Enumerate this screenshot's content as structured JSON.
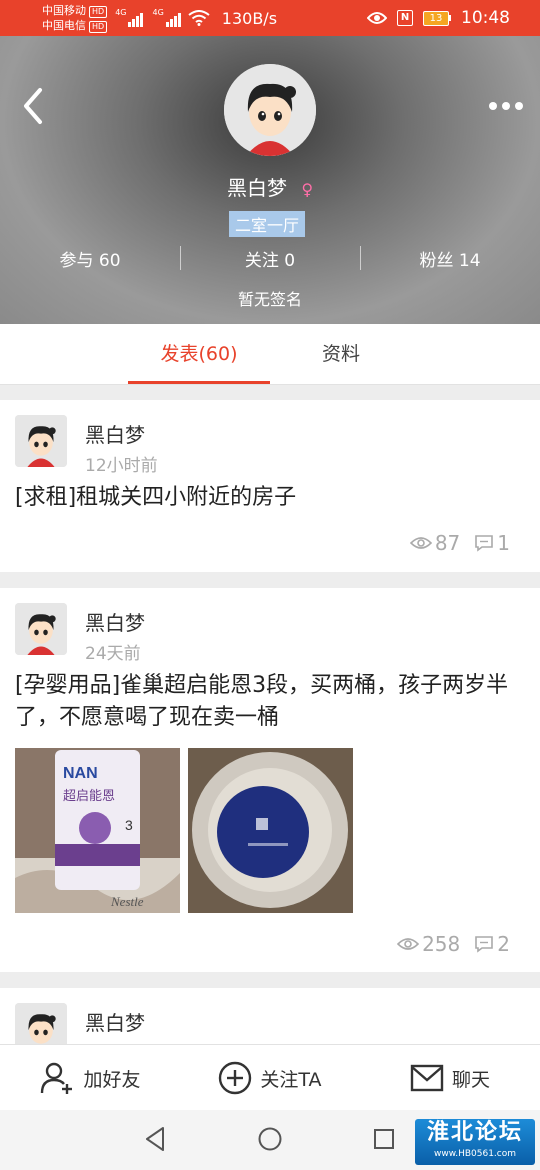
{
  "status_bar": {
    "carrier1": "中国移动",
    "carrier2": "中国电信",
    "hd": "HD",
    "net1": "4G",
    "net2": "4G",
    "net_speed": "130B/s",
    "battery": "13",
    "time": "10:48",
    "icons": [
      "eye-icon",
      "nfc-icon",
      "battery-icon",
      "wifi-icon",
      "signal-icon"
    ]
  },
  "profile": {
    "name": "黑白梦",
    "gender_icon": "female-symbol-icon",
    "gender_color": "#ff6fa8",
    "badge": "二室一厅",
    "stats": [
      {
        "label": "参与 60"
      },
      {
        "label": "关注 0"
      },
      {
        "label": "粉丝 14"
      }
    ],
    "signature": "暂无签名"
  },
  "tabs": [
    {
      "label": "发表(60)",
      "active": true
    },
    {
      "label": "资料",
      "active": false
    }
  ],
  "posts": [
    {
      "author": "黑白梦",
      "time": "12小时前",
      "title": "[求租]租城关四小附近的房子",
      "views": "87",
      "comments": "1"
    },
    {
      "author": "黑白梦",
      "time": "24天前",
      "title": "[孕婴用品]雀巢超启能恩3段，买两桶，孩子两岁半了，不愿意喝了现在卖一桶",
      "images": [
        {
          "text": [
            "NAN",
            "超启能恩",
            "3",
            "Nestle"
          ]
        },
        {
          "text": []
        }
      ],
      "views": "258",
      "comments": "2"
    },
    {
      "author": "黑白梦"
    }
  ],
  "action_bar": [
    {
      "label": "加好友",
      "icon": "add-user-icon"
    },
    {
      "label": "关注TA",
      "icon": "plus-circle-icon"
    },
    {
      "label": "聊天",
      "icon": "mail-icon"
    }
  ],
  "watermark": {
    "logo": "淮北论坛",
    "url": "www.HB0561.com"
  },
  "colors": {
    "accent": "#e8422b",
    "badge_bg": "#a9c9ea",
    "watermark_bg": "#1d8cd8"
  }
}
